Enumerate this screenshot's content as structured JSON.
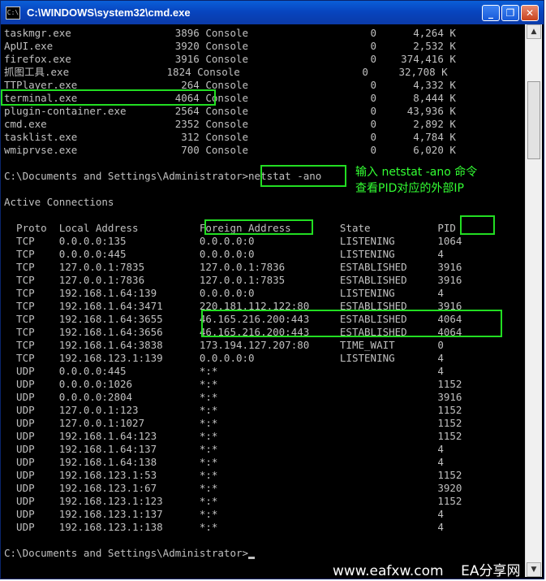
{
  "window": {
    "title": "C:\\WINDOWS\\system32\\cmd.exe",
    "icon_text": "C:\\",
    "minimize_label": "_",
    "maximize_label": "❐",
    "close_label": "✕"
  },
  "lines": [
    "taskmgr.exe                 3896 Console                    0      4,264 K",
    "ApUI.exe                    3920 Console                    0      2,532 K",
    "firefox.exe                 3916 Console                    0    374,416 K",
    "抓图工具.exe                1824 Console                    0     32,708 K",
    "TTPlayer.exe                 264 Console                    0      4,332 K",
    "terminal.exe                4064 Console                    0      8,444 K",
    "plugin-container.exe        2564 Console                    0     43,936 K",
    "cmd.exe                     2352 Console                    0      2,892 K",
    "tasklist.exe                 312 Console                    0      4,784 K",
    "wmiprvse.exe                 700 Console                    0      6,020 K",
    "",
    "C:\\Documents and Settings\\Administrator>netstat -ano",
    "",
    "Active Connections",
    "",
    "  Proto  Local Address          Foreign Address        State           PID",
    "  TCP    0.0.0.0:135            0.0.0.0:0              LISTENING       1064",
    "  TCP    0.0.0.0:445            0.0.0.0:0              LISTENING       4",
    "  TCP    127.0.0.1:7835         127.0.0.1:7836         ESTABLISHED     3916",
    "  TCP    127.0.0.1:7836         127.0.0.1:7835         ESTABLISHED     3916",
    "  TCP    192.168.1.64:139       0.0.0.0:0              LISTENING       4",
    "  TCP    192.168.1.64:3471      220.181.112.122:80     ESTABLISHED     3916",
    "  TCP    192.168.1.64:3655      46.165.216.200:443     ESTABLISHED     4064",
    "  TCP    192.168.1.64:3656      46.165.216.200:443     ESTABLISHED     4064",
    "  TCP    192.168.1.64:3838      173.194.127.207:80     TIME_WAIT       0",
    "  TCP    192.168.123.1:139      0.0.0.0:0              LISTENING       4",
    "  UDP    0.0.0.0:445            *:*                                    4",
    "  UDP    0.0.0.0:1026           *:*                                    1152",
    "  UDP    0.0.0.0:2804           *:*                                    3916",
    "  UDP    127.0.0.1:123          *:*                                    1152",
    "  UDP    127.0.0.1:1027         *:*                                    1152",
    "  UDP    192.168.1.64:123       *:*                                    1152",
    "  UDP    192.168.1.64:137       *:*                                    4",
    "  UDP    192.168.1.64:138       *:*                                    4",
    "  UDP    192.168.123.1:53       *:*                                    1152",
    "  UDP    192.168.123.1:67       *:*                                    3920",
    "  UDP    192.168.123.1:123      *:*                                    1152",
    "  UDP    192.168.123.1:137      *:*                                    4",
    "  UDP    192.168.123.1:138      *:*                                    4",
    "",
    "C:\\Documents and Settings\\Administrator>"
  ],
  "annotation": {
    "line1": "输入 netstat -ano 命令",
    "line2": "查看PID对应的外部IP"
  },
  "watermark": "www.eafxw.com    EA分享网",
  "colors": {
    "console_bg": "#000000",
    "console_text": "#c0c0c0",
    "highlight": "#22dd22",
    "annotation": "#33ff33"
  }
}
